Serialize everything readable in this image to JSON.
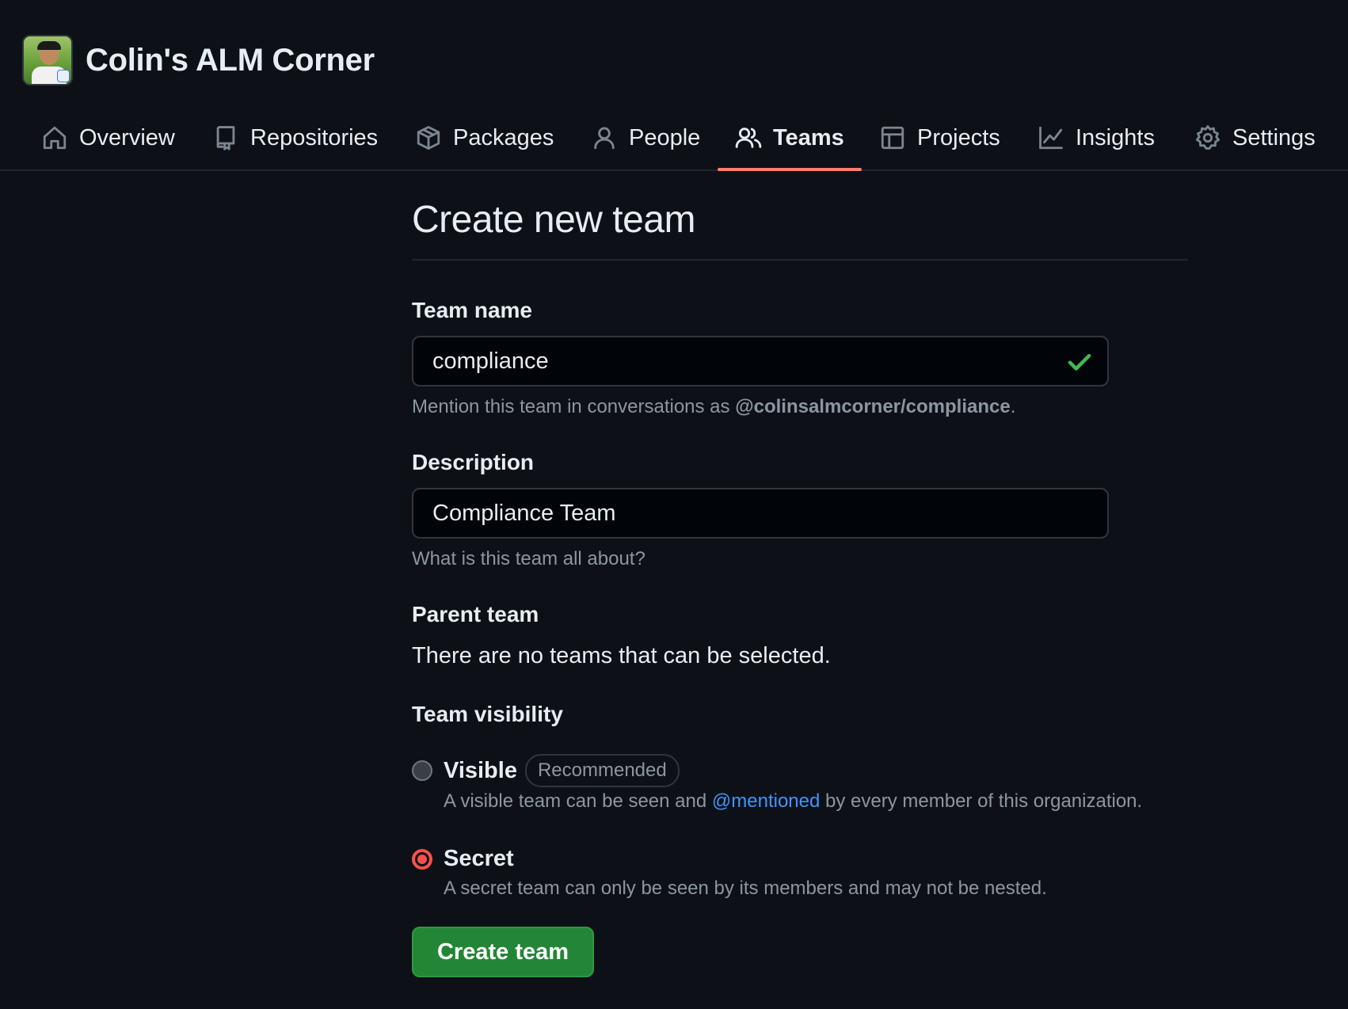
{
  "org": {
    "name": "Colin's ALM Corner"
  },
  "nav": {
    "tabs": [
      {
        "label": "Overview",
        "icon": "home-icon"
      },
      {
        "label": "Repositories",
        "icon": "repo-icon"
      },
      {
        "label": "Packages",
        "icon": "package-icon"
      },
      {
        "label": "People",
        "icon": "person-icon"
      },
      {
        "label": "Teams",
        "icon": "people-icon",
        "active": true
      },
      {
        "label": "Projects",
        "icon": "table-icon"
      },
      {
        "label": "Insights",
        "icon": "graph-icon"
      },
      {
        "label": "Settings",
        "icon": "gear-icon"
      }
    ]
  },
  "form": {
    "title": "Create new team",
    "team_name": {
      "label": "Team name",
      "value": "compliance",
      "note_prefix": "Mention this team in conversations as ",
      "note_mention": "@colinsalmcorner/compliance",
      "note_suffix": "."
    },
    "description": {
      "label": "Description",
      "value": "Compliance Team",
      "note": "What is this team all about?"
    },
    "parent_team": {
      "label": "Parent team",
      "text": "There are no teams that can be selected."
    },
    "visibility": {
      "label": "Team visibility",
      "options": [
        {
          "title": "Visible",
          "badge": "Recommended",
          "desc_prefix": "A visible team can be seen and ",
          "desc_link": "@mentioned",
          "desc_suffix": " by every member of this organization.",
          "checked": false
        },
        {
          "title": "Secret",
          "desc": "A secret team can only be seen by its members and may not be nested.",
          "checked": true
        }
      ]
    },
    "submit_label": "Create team"
  },
  "colors": {
    "background": "#0d1117",
    "accent_underline": "#f78166",
    "primary_button": "#238636",
    "radio_checked": "#f85149",
    "link": "#4493f8",
    "check_icon": "#3fb950"
  }
}
